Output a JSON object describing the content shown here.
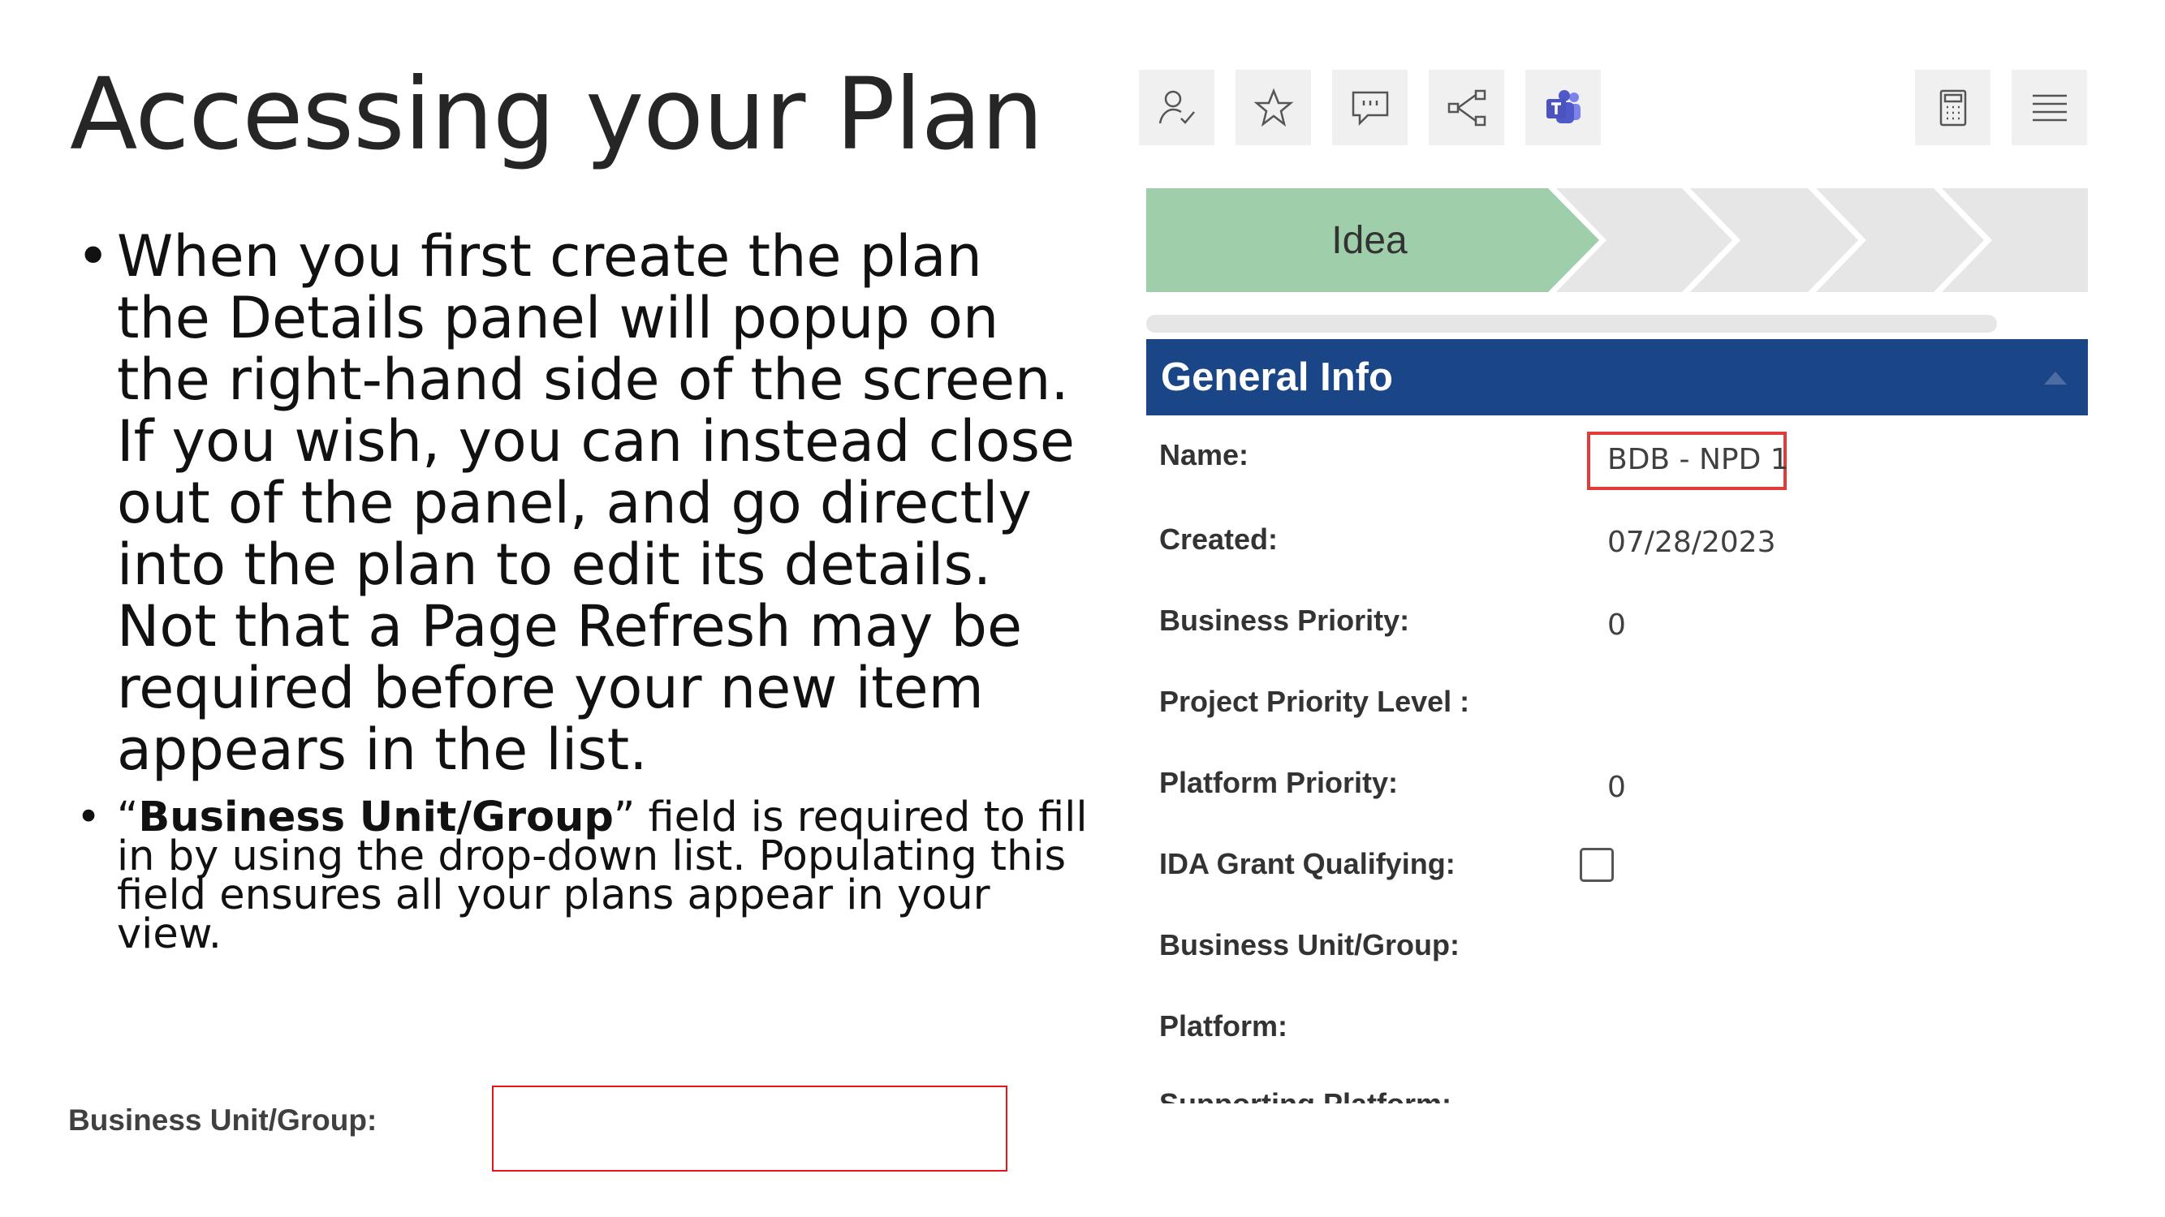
{
  "slide": {
    "title": "Accessing your Plan",
    "bullet_1": "When you first create the plan the Details panel will popup on the right-hand side of the screen. If you wish, you can instead close out of the panel, and go directly into the plan to edit its details. Not that a Page Refresh may be required before your new item appears in the list.",
    "bullet_2_open_quote": "“",
    "bullet_2_bold": "Business Unit/Group",
    "bullet_2_rest": "” field is required to fill in by using the drop-down list. Populating this field ensures all your plans appear in your view.",
    "bullet_symbol": "•"
  },
  "callout": {
    "label": "Business Unit/Group:",
    "value": ""
  },
  "toolbar": {
    "buttons": [
      {
        "icon": "assign-user-icon"
      },
      {
        "icon": "favorite-star-icon"
      },
      {
        "icon": "comment-icon"
      },
      {
        "icon": "share-icon"
      },
      {
        "icon": "teams-icon"
      },
      {
        "icon": "calculator-icon"
      },
      {
        "icon": "menu-icon"
      }
    ]
  },
  "stage": {
    "current": "Idea",
    "active_color": "#9fcfaa",
    "inactive_color": "#e6e6e6"
  },
  "panel": {
    "title": "General Info",
    "header_color": "#1a4687",
    "fields": {
      "name": {
        "label": "Name:",
        "value": "BDB - NPD 1"
      },
      "created": {
        "label": "Created:",
        "value": "07/28/2023"
      },
      "business_priority": {
        "label": "Business Priority:",
        "value": "0"
      },
      "project_priority_level": {
        "label": "Project Priority Level :",
        "value": ""
      },
      "platform_priority": {
        "label": "Platform Priority:",
        "value": "0"
      },
      "ida_grant_qualifying": {
        "label": "IDA Grant Qualifying:",
        "checked": false
      },
      "business_unit_group": {
        "label": "Business Unit/Group:",
        "value": ""
      },
      "platform": {
        "label": "Platform:",
        "value": ""
      },
      "cut_off": {
        "label": "Supporting Platform:"
      }
    }
  }
}
